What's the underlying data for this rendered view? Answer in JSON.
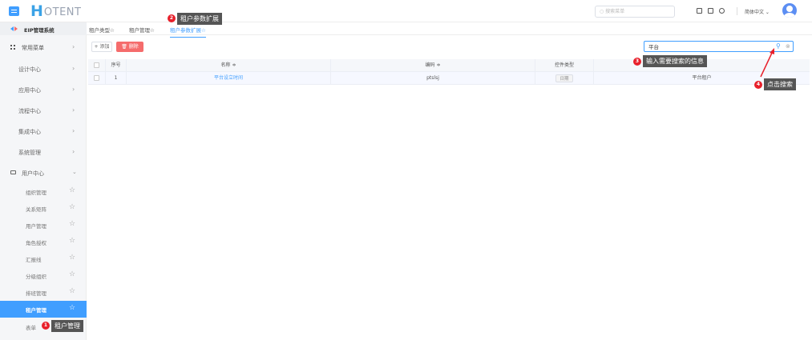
{
  "header": {
    "logo_h": "H",
    "logo_rest": "OTENT",
    "search_placeholder": "搜索菜单",
    "language": "简体中文"
  },
  "sidebar": {
    "system_name": "EIP管理系统",
    "menus": [
      {
        "label": "常用菜单",
        "icon": "grid-icon"
      },
      {
        "label": "设计中心"
      },
      {
        "label": "应用中心"
      },
      {
        "label": "流程中心"
      },
      {
        "label": "集成中心"
      },
      {
        "label": "系统管理"
      },
      {
        "label": "用户中心",
        "icon": "monitor-icon",
        "expanded": true
      }
    ],
    "sub_items": [
      {
        "label": "组织管理"
      },
      {
        "label": "关系矩阵"
      },
      {
        "label": "用户管理"
      },
      {
        "label": "角色授权"
      },
      {
        "label": "汇报线"
      },
      {
        "label": "分级组织"
      },
      {
        "label": "排班管理"
      },
      {
        "label": "租户管理",
        "active": true
      },
      {
        "label": "表单"
      }
    ]
  },
  "tabs": [
    {
      "label": "租户类型☆"
    },
    {
      "label": "租户管理☆"
    },
    {
      "label": "租户参数扩展☆",
      "active": true
    }
  ],
  "toolbar": {
    "add_label": "+ 添加",
    "delete_label": "🗑 删除",
    "search_value": "平台"
  },
  "table": {
    "headers": [
      "",
      "序号",
      "名称 ≑",
      "编码 ≑",
      "控件类型",
      ""
    ],
    "rows": [
      {
        "index": "1",
        "name": "平台设立时间",
        "code": "ptslsj",
        "control_type": "日期",
        "extra": "平台租户"
      }
    ]
  },
  "callouts": [
    {
      "num": "1",
      "text": "租户管理"
    },
    {
      "num": "2",
      "text": "租户参数扩展"
    },
    {
      "num": "3",
      "text": "输入需要搜索的信息"
    },
    {
      "num": "4",
      "text": "点击搜索"
    }
  ],
  "colors": {
    "accent": "#409eff",
    "danger": "#f56c6c",
    "callout_badge": "#e8202b",
    "callout_bg": "#555555"
  }
}
